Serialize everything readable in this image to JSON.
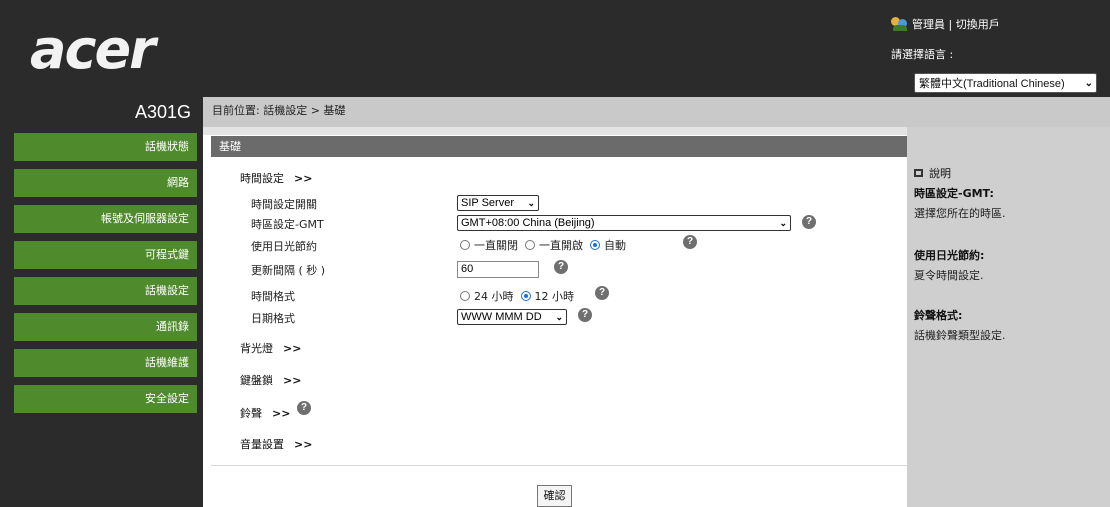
{
  "header": {
    "logo": "acer",
    "user_links": "管理員 | 切換用戶",
    "language_label": "請選擇語言 :",
    "language_value": "繁體中文(Traditional Chinese)"
  },
  "sidebar": {
    "model": "A301G",
    "items": [
      {
        "label": "話機狀態"
      },
      {
        "label": "網路"
      },
      {
        "label": "帳號及伺服器設定"
      },
      {
        "label": "可程式鍵"
      },
      {
        "label": "話機設定"
      },
      {
        "label": "通訊錄"
      },
      {
        "label": "話機維護"
      },
      {
        "label": "安全設定"
      }
    ]
  },
  "breadcrumb": "目前位置: 話機設定 > 基礎",
  "main": {
    "section_title": "基礎",
    "time_settings": {
      "title": "時間設定",
      "arrow": ">>",
      "switch_label": "時間設定開關",
      "switch_value": "SIP Server",
      "tz_label": "時區設定-GMT",
      "tz_value": "GMT+08:00 China (Beijing)",
      "dst_label": "使用日光節約",
      "dst_options": [
        "一直關閉",
        "一直開啟",
        "自動"
      ],
      "interval_label": "更新間隔 ( 秒 )",
      "interval_value": "60",
      "format_label": "時間格式",
      "format_options": [
        "24 小時",
        "12 小時"
      ],
      "date_label": "日期格式",
      "date_value": "WWW MMM DD"
    },
    "groups": [
      {
        "title": "背光燈",
        "arrow": ">>"
      },
      {
        "title": "鍵盤鎖",
        "arrow": ">>"
      },
      {
        "title": "鈴聲",
        "arrow": ">>"
      },
      {
        "title": "音量設置",
        "arrow": ">>"
      }
    ],
    "help_icon": "?",
    "confirm": "確認"
  },
  "help_panel": {
    "title": "說明",
    "entries": [
      {
        "title": "時區設定-GMT:",
        "desc": "選擇您所在的時區."
      },
      {
        "title": "使用日光節約:",
        "desc": "夏令時間設定."
      },
      {
        "title": "鈴聲格式:",
        "desc": "話機鈴聲類型設定."
      }
    ]
  },
  "selections": {
    "dst": "自動",
    "time_format": "12 小時"
  }
}
